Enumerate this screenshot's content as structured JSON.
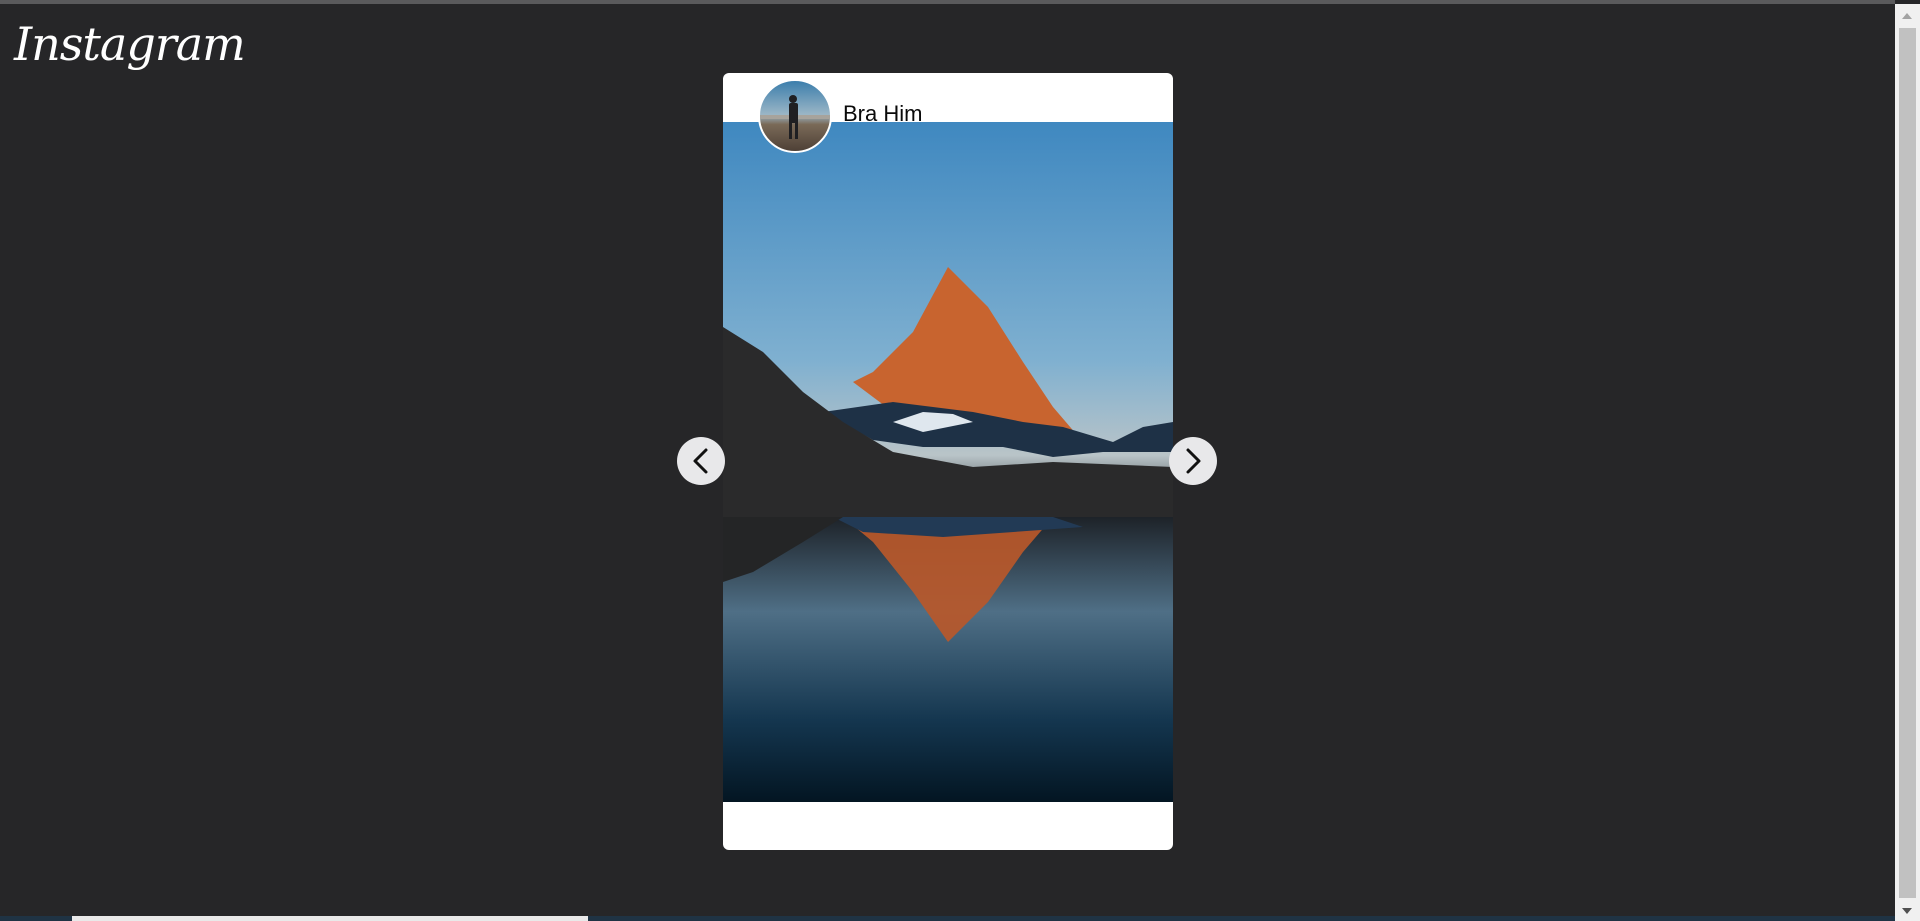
{
  "header": {
    "logo_text": "Instagram"
  },
  "post": {
    "username": "Bra Him",
    "avatar_icon": "profile-photo",
    "image_icon": "mountain-lake-reflection-photo"
  },
  "carousel": {
    "prev_icon": "chevron-left-icon",
    "next_icon": "chevron-right-icon"
  },
  "colors": {
    "background": "#262628",
    "card": "#ffffff",
    "nav_button": "#e8e8ea"
  }
}
